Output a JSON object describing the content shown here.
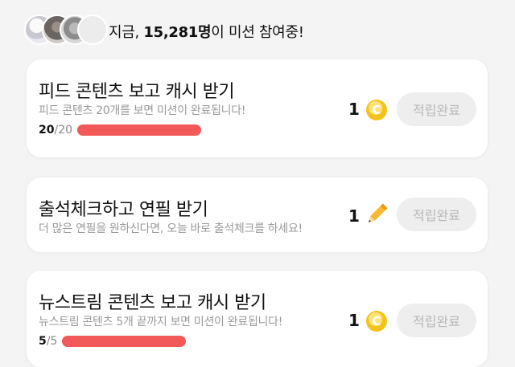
{
  "header": {
    "prefix": "지금, ",
    "count": "15,281명",
    "suffix": "이 미션 참여중!"
  },
  "missions": [
    {
      "title": "피드 콘텐츠 보고 캐시 받기",
      "description": "피드 콘텐츠 20개를 보면 미션이 완료됩니다!",
      "progress_current": "20",
      "progress_total": "/20",
      "progress_fraction": 1.0,
      "reward_count": "1",
      "reward_icon": "coin-icon",
      "reward_symbol": "C",
      "button_label": "적립완료"
    },
    {
      "title": "출석체크하고 연필 받기",
      "description": "더 많은 연필을 원하신다면, 오늘 바로 출석체크를 하세요!",
      "reward_count": "1",
      "reward_icon": "pencil-icon",
      "button_label": "적립완료"
    },
    {
      "title": "뉴스트림 콘텐츠 보고 캐시 받기",
      "description": "뉴스트림 콘텐츠 5개 끝까지 보면 미션이 완료됩니다!",
      "progress_current": "5",
      "progress_total": "/5",
      "progress_fraction": 1.0,
      "reward_count": "1",
      "reward_icon": "coin-icon",
      "reward_symbol": "C",
      "button_label": "적립완료"
    }
  ],
  "colors": {
    "progress_bar": "#f25a5a",
    "coin": "#f4c21d",
    "button_bg": "#eeeeee",
    "button_text": "#b8b8b8"
  }
}
